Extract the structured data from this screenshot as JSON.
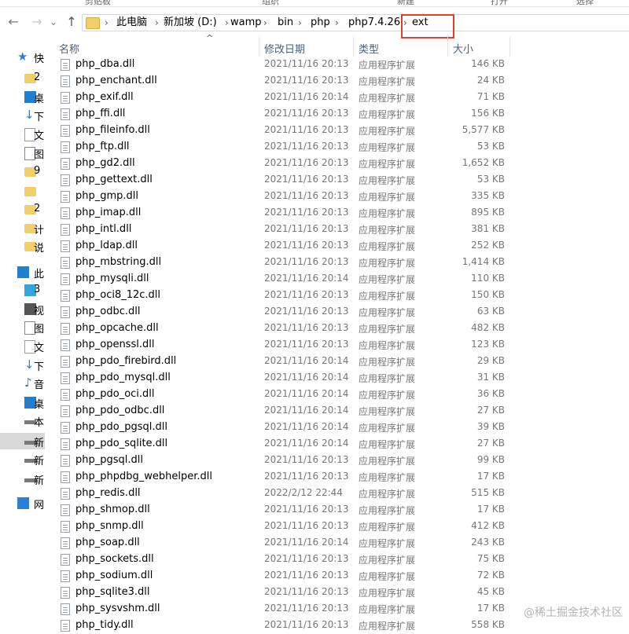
{
  "ribbon": {
    "labels": [
      "剪贴板",
      "组织",
      "新建",
      "打开",
      "选择"
    ]
  },
  "nav": {
    "back_icon": "←",
    "forward_icon": "→",
    "dropdown_icon": "⌄",
    "up_icon": "↑"
  },
  "address": {
    "crumbs": [
      "此电脑",
      "新加坡 (D:)",
      "wamp",
      "bin",
      "php",
      "php7.4.26",
      "ext"
    ],
    "separator": "›"
  },
  "sidebar": {
    "items": [
      {
        "icon": "star-icon",
        "glyph": "★",
        "color": "#2b7fd6",
        "text": "快"
      },
      {
        "icon": "folder-icon",
        "glyph": "",
        "color": "#f3cf6a",
        "text": "2"
      },
      {
        "icon": "desktop-icon",
        "glyph": "",
        "color": "#1f7fd1",
        "text": "桌"
      },
      {
        "icon": "download-icon",
        "glyph": "↓",
        "color": "#2b7fd6",
        "text": "下"
      },
      {
        "icon": "document-icon",
        "glyph": "",
        "color": "#9aa0a6",
        "text": "文"
      },
      {
        "icon": "picture-icon",
        "glyph": "",
        "color": "#6b8fb3",
        "text": "图"
      },
      {
        "icon": "folder-icon",
        "glyph": "",
        "color": "#f3cf6a",
        "text": "9"
      },
      {
        "icon": "folder-icon",
        "glyph": "",
        "color": "#f3cf6a",
        "text": ""
      },
      {
        "icon": "folder-icon",
        "glyph": "",
        "color": "#f3cf6a",
        "text": "2"
      },
      {
        "icon": "folder-icon",
        "glyph": "",
        "color": "#f3cf6a",
        "text": "计"
      },
      {
        "icon": "folder-icon",
        "glyph": "",
        "color": "#f3cf6a",
        "text": "说"
      },
      {
        "icon": "pc-icon",
        "glyph": "",
        "color": "#1f7fd1",
        "text": "此"
      },
      {
        "icon": "3d-icon",
        "glyph": "",
        "color": "#35a4dc",
        "text": "3"
      },
      {
        "icon": "video-icon",
        "glyph": "",
        "color": "#555",
        "text": "视"
      },
      {
        "icon": "picture-icon",
        "glyph": "",
        "color": "#6b8fb3",
        "text": "图"
      },
      {
        "icon": "document-icon",
        "glyph": "",
        "color": "#9aa0a6",
        "text": "文"
      },
      {
        "icon": "download-icon",
        "glyph": "↓",
        "color": "#2b7fd6",
        "text": "下"
      },
      {
        "icon": "music-icon",
        "glyph": "♪",
        "color": "#2b7fd6",
        "text": "音"
      },
      {
        "icon": "desktop-icon",
        "glyph": "",
        "color": "#1f7fd1",
        "text": "桌"
      },
      {
        "icon": "windows-drive-icon",
        "glyph": "",
        "color": "#7a7a7a",
        "text": "本"
      },
      {
        "icon": "drive-icon",
        "glyph": "",
        "color": "#7a7a7a",
        "text": "新"
      },
      {
        "icon": "drive-icon",
        "glyph": "",
        "color": "#7a7a7a",
        "text": "新"
      },
      {
        "icon": "drive-icon",
        "glyph": "",
        "color": "#7a7a7a",
        "text": "新"
      },
      {
        "icon": "network-icon",
        "glyph": "",
        "color": "#2b7fd6",
        "text": "网"
      }
    ]
  },
  "columns": {
    "name": "名称",
    "date": "修改日期",
    "type": "类型",
    "size": "大小",
    "sort_icon": "^"
  },
  "files": [
    {
      "name": "php_dba.dll",
      "date": "2021/11/16 20:13",
      "type": "应用程序扩展",
      "size": "146 KB"
    },
    {
      "name": "php_enchant.dll",
      "date": "2021/11/16 20:13",
      "type": "应用程序扩展",
      "size": "24 KB"
    },
    {
      "name": "php_exif.dll",
      "date": "2021/11/16 20:14",
      "type": "应用程序扩展",
      "size": "71 KB"
    },
    {
      "name": "php_ffi.dll",
      "date": "2021/11/16 20:13",
      "type": "应用程序扩展",
      "size": "156 KB"
    },
    {
      "name": "php_fileinfo.dll",
      "date": "2021/11/16 20:13",
      "type": "应用程序扩展",
      "size": "5,577 KB"
    },
    {
      "name": "php_ftp.dll",
      "date": "2021/11/16 20:13",
      "type": "应用程序扩展",
      "size": "53 KB"
    },
    {
      "name": "php_gd2.dll",
      "date": "2021/11/16 20:13",
      "type": "应用程序扩展",
      "size": "1,652 KB"
    },
    {
      "name": "php_gettext.dll",
      "date": "2021/11/16 20:13",
      "type": "应用程序扩展",
      "size": "53 KB"
    },
    {
      "name": "php_gmp.dll",
      "date": "2021/11/16 20:13",
      "type": "应用程序扩展",
      "size": "335 KB"
    },
    {
      "name": "php_imap.dll",
      "date": "2021/11/16 20:13",
      "type": "应用程序扩展",
      "size": "895 KB"
    },
    {
      "name": "php_intl.dll",
      "date": "2021/11/16 20:13",
      "type": "应用程序扩展",
      "size": "381 KB"
    },
    {
      "name": "php_ldap.dll",
      "date": "2021/11/16 20:13",
      "type": "应用程序扩展",
      "size": "252 KB"
    },
    {
      "name": "php_mbstring.dll",
      "date": "2021/11/16 20:13",
      "type": "应用程序扩展",
      "size": "1,414 KB"
    },
    {
      "name": "php_mysqli.dll",
      "date": "2021/11/16 20:14",
      "type": "应用程序扩展",
      "size": "110 KB"
    },
    {
      "name": "php_oci8_12c.dll",
      "date": "2021/11/16 20:13",
      "type": "应用程序扩展",
      "size": "150 KB"
    },
    {
      "name": "php_odbc.dll",
      "date": "2021/11/16 20:13",
      "type": "应用程序扩展",
      "size": "63 KB"
    },
    {
      "name": "php_opcache.dll",
      "date": "2021/11/16 20:13",
      "type": "应用程序扩展",
      "size": "482 KB"
    },
    {
      "name": "php_openssl.dll",
      "date": "2021/11/16 20:13",
      "type": "应用程序扩展",
      "size": "123 KB"
    },
    {
      "name": "php_pdo_firebird.dll",
      "date": "2021/11/16 20:14",
      "type": "应用程序扩展",
      "size": "29 KB"
    },
    {
      "name": "php_pdo_mysql.dll",
      "date": "2021/11/16 20:14",
      "type": "应用程序扩展",
      "size": "31 KB"
    },
    {
      "name": "php_pdo_oci.dll",
      "date": "2021/11/16 20:14",
      "type": "应用程序扩展",
      "size": "36 KB"
    },
    {
      "name": "php_pdo_odbc.dll",
      "date": "2021/11/16 20:14",
      "type": "应用程序扩展",
      "size": "27 KB"
    },
    {
      "name": "php_pdo_pgsql.dll",
      "date": "2021/11/16 20:14",
      "type": "应用程序扩展",
      "size": "39 KB"
    },
    {
      "name": "php_pdo_sqlite.dll",
      "date": "2021/11/16 20:14",
      "type": "应用程序扩展",
      "size": "27 KB"
    },
    {
      "name": "php_pgsql.dll",
      "date": "2021/11/16 20:13",
      "type": "应用程序扩展",
      "size": "99 KB"
    },
    {
      "name": "php_phpdbg_webhelper.dll",
      "date": "2021/11/16 20:13",
      "type": "应用程序扩展",
      "size": "17 KB"
    },
    {
      "name": "php_redis.dll",
      "date": "2022/2/12 22:44",
      "type": "应用程序扩展",
      "size": "515 KB"
    },
    {
      "name": "php_shmop.dll",
      "date": "2021/11/16 20:13",
      "type": "应用程序扩展",
      "size": "17 KB"
    },
    {
      "name": "php_snmp.dll",
      "date": "2021/11/16 20:13",
      "type": "应用程序扩展",
      "size": "412 KB"
    },
    {
      "name": "php_soap.dll",
      "date": "2021/11/16 20:14",
      "type": "应用程序扩展",
      "size": "243 KB"
    },
    {
      "name": "php_sockets.dll",
      "date": "2021/11/16 20:13",
      "type": "应用程序扩展",
      "size": "75 KB"
    },
    {
      "name": "php_sodium.dll",
      "date": "2021/11/16 20:13",
      "type": "应用程序扩展",
      "size": "72 KB"
    },
    {
      "name": "php_sqlite3.dll",
      "date": "2021/11/16 20:13",
      "type": "应用程序扩展",
      "size": "45 KB"
    },
    {
      "name": "php_sysvshm.dll",
      "date": "2021/11/16 20:13",
      "type": "应用程序扩展",
      "size": "17 KB"
    },
    {
      "name": "php_tidy.dll",
      "date": "2021/11/16 20:13",
      "type": "应用程序扩展",
      "size": "558 KB"
    }
  ],
  "watermark": "@稀土掘金技术社区",
  "colors": {
    "highlight_border": "#e43d30",
    "selected_sidebar": "#d9d9d9",
    "header_text": "#4c607a"
  }
}
